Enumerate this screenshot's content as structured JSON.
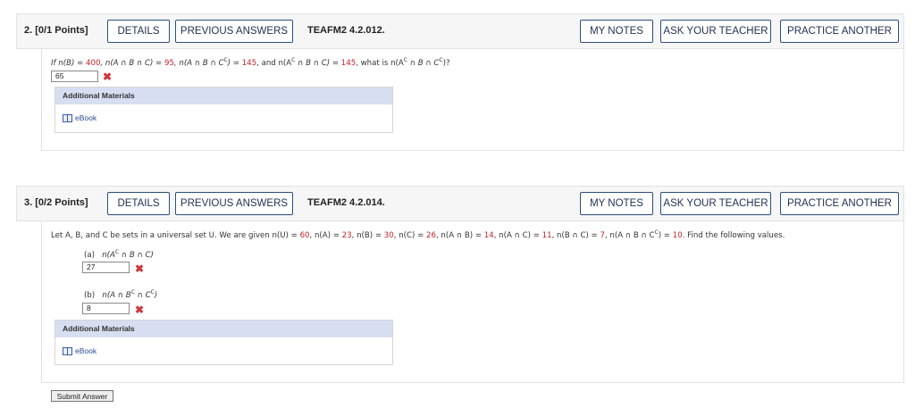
{
  "q2": {
    "number": "2.",
    "points": "[0/1 Points]",
    "details": "DETAILS",
    "previous_answers": "PREVIOUS ANSWERS",
    "code": "TEAFM2 4.2.012.",
    "my_notes": "MY NOTES",
    "ask_teacher": "ASK YOUR TEACHER",
    "practice_another": "PRACTICE ANOTHER",
    "problem": {
      "t1": "If n(B) = ",
      "v1": "400",
      "t2": ", n(A ∩ B ∩ C) = ",
      "v2": "95",
      "t3a": ", n(A ∩ B ∩ C",
      "sup1": "C",
      "t3b": ") = ",
      "v3": "145",
      "t4a": ", and n(A",
      "sup2": "C",
      "t4b": " ∩ B ∩ C) = ",
      "v4": "145",
      "t5a": ", what is n(A",
      "sup3": "C",
      "t5b": " ∩ B ∩ C",
      "sup4": "C",
      "t5c": ")?"
    },
    "answer": "65",
    "materials_title": "Additional Materials",
    "ebook": "eBook"
  },
  "q3": {
    "number": "3.",
    "points": "[0/2 Points]",
    "details": "DETAILS",
    "previous_answers": "PREVIOUS ANSWERS",
    "code": "TEAFM2 4.2.014.",
    "my_notes": "MY NOTES",
    "ask_teacher": "ASK YOUR TEACHER",
    "practice_another": "PRACTICE ANOTHER",
    "problem": {
      "t1": "Let A, B, and C be sets in a universal set U. We are given n(U) = ",
      "v1": "60",
      "t2": ", n(A) = ",
      "v2": "23",
      "t3": ", n(B) = ",
      "v3": "30",
      "t4": ", n(C) = ",
      "v4": "26",
      "t5": ", n(A ∩ B) = ",
      "v5": "14",
      "t6": ", n(A ∩ C) = ",
      "v6": "11",
      "t7": ", n(B ∩ C) = ",
      "v7": "7",
      "t8a": ", n(A ∩ B ∩ C",
      "sup1": "C",
      "t8b": ") = ",
      "v8": "10",
      "t9": ". Find the following values."
    },
    "part_a": {
      "label": "(a)",
      "expr_a": "n(A",
      "sup": "C",
      "expr_b": " ∩ B ∩ C)",
      "answer": "27"
    },
    "part_b": {
      "label": "(b)",
      "expr_a": "n(A ∩ B",
      "sup1": "C",
      "expr_b": " ∩ C",
      "sup2": "C",
      "expr_c": ")",
      "answer": "8"
    },
    "materials_title": "Additional Materials",
    "ebook": "eBook",
    "submit": "Submit Answer"
  },
  "icons": {
    "incorrect": "x-mark-icon",
    "ebook": "book-icon"
  },
  "colors": {
    "accent": "#2b4e7e",
    "error": "#d0353d",
    "value_red": "#c6222b",
    "materials_header": "#d8def1"
  }
}
